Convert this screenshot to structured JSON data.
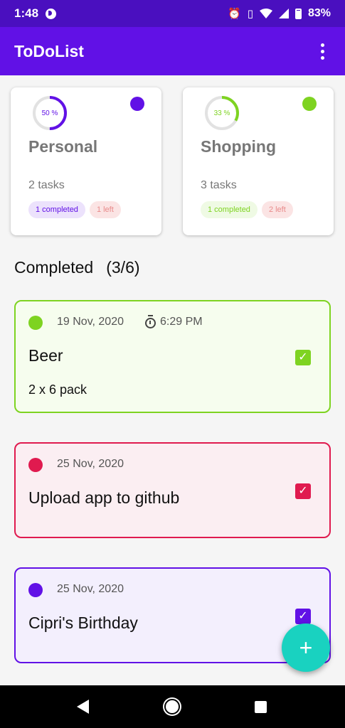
{
  "status_bar": {
    "time": "1:48",
    "battery": "83%"
  },
  "app_bar": {
    "title": "ToDoList",
    "menu_icon": "more-vert-icon"
  },
  "categories": [
    {
      "name": "Personal",
      "percent": 50,
      "percent_label": "50 %",
      "tasks": "2 tasks",
      "completed": "1 completed",
      "left": "1 left",
      "color": "#6111e6"
    },
    {
      "name": "Shopping",
      "percent": 33,
      "percent_label": "33 %",
      "tasks": "3 tasks",
      "completed": "1 completed",
      "left": "2 left",
      "color": "#7ed321"
    }
  ],
  "section": {
    "title": "Completed",
    "count": "(3/6)"
  },
  "tasks": [
    {
      "date": "19 Nov, 2020",
      "time": "6:29 PM",
      "title": "Beer",
      "note": "2 x 6 pack",
      "color": "#7ed321",
      "bg": "#f6fdee",
      "checked": true
    },
    {
      "date": "25 Nov, 2020",
      "title": "Upload app to github",
      "color": "#e01a4f",
      "bg": "#fbeef2",
      "checked": true
    },
    {
      "date": "25 Nov, 2020",
      "title": "Cipri's Birthday",
      "color": "#6111e6",
      "bg": "#f3effd",
      "checked": true
    }
  ],
  "fab": {
    "icon": "plus-icon"
  }
}
